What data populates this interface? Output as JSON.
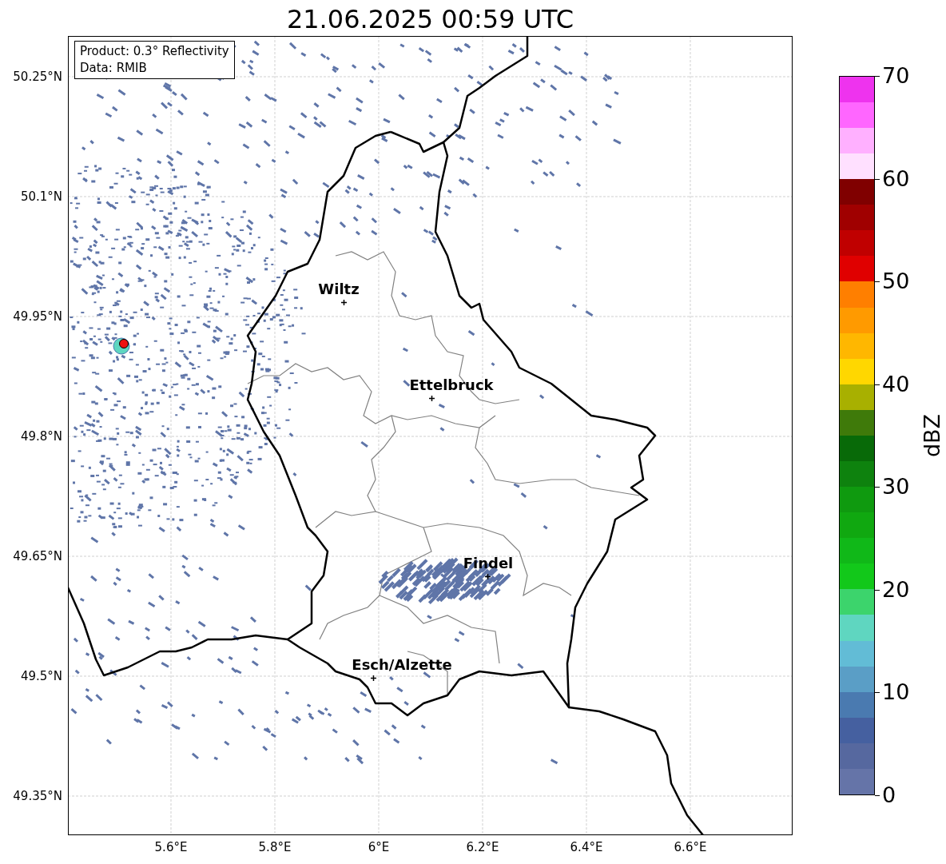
{
  "title": "21.06.2025 00:59 UTC",
  "info_box": [
    "Product: 0.3° Reflectivity",
    "Data: RMIB"
  ],
  "lat_ticks": [
    "50.25°N",
    "50.1°N",
    "49.95°N",
    "49.8°N",
    "49.65°N",
    "49.5°N",
    "49.35°N"
  ],
  "lon_ticks": [
    "5.6°E",
    "5.8°E",
    "6°E",
    "6.2°E",
    "6.4°E",
    "6.6°E"
  ],
  "cities": [
    {
      "name": "Wiltz"
    },
    {
      "name": "Ettelbruck"
    },
    {
      "name": "Findel"
    },
    {
      "name": "Esch/Alzette"
    }
  ],
  "colorbar": {
    "label": "dBZ",
    "ticks": [
      "70",
      "60",
      "50",
      "40",
      "30",
      "20",
      "10",
      "0"
    ],
    "segments": [
      {
        "color": "#6574a8"
      },
      {
        "color": "#56689f"
      },
      {
        "color": "#4560a0"
      },
      {
        "color": "#4a7ab0"
      },
      {
        "color": "#5a9ec6"
      },
      {
        "color": "#62bcd6"
      },
      {
        "color": "#5fd6c0"
      },
      {
        "color": "#3cd46c"
      },
      {
        "color": "#12c81a"
      },
      {
        "color": "#10b818"
      },
      {
        "color": "#10a810"
      },
      {
        "color": "#0f9a0f"
      },
      {
        "color": "#0e820e"
      },
      {
        "color": "#086a08"
      },
      {
        "color": "#3f7a0a"
      },
      {
        "color": "#a8b000"
      },
      {
        "color": "#ffd700"
      },
      {
        "color": "#ffb700"
      },
      {
        "color": "#ff9a00"
      },
      {
        "color": "#ff7f00"
      },
      {
        "color": "#e00000"
      },
      {
        "color": "#c00000"
      },
      {
        "color": "#a00000"
      },
      {
        "color": "#800000"
      },
      {
        "color": "#ffe0ff"
      },
      {
        "color": "#ffb0ff"
      },
      {
        "color": "#ff66ff"
      },
      {
        "color": "#ee33ee"
      }
    ]
  }
}
